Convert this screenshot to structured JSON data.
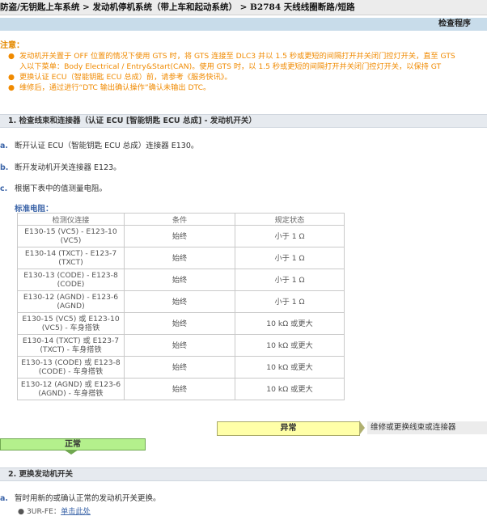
{
  "breadcrumb": {
    "text": "防盗/无钥匙上车系统 > 发动机停机系统（带上车和起动系统） > B2784 天线线圈断路/短路"
  },
  "procedure_header": "检查程序",
  "notice": {
    "title": "注意：",
    "items": [
      {
        "line1": "发动机开关置于 OFF 位置的情况下使用 GTS 时，将 GTS 连接至 DLC3 并以 1.5 秒或更短的间隔打开并关闭门控灯开关，直至 GTS",
        "line2": "入以下菜单：Body Electrical / Entry&Start(CAN)。使用 GTS 时，以 1.5 秒或更短的间隔打开并关闭门控灯开关，以保持 GT"
      },
      {
        "line1": "更换认证 ECU（智能钥匙 ECU 总成）前，请参考《服务快讯》。"
      },
      {
        "line1": "维修后，通过进行“DTC 输出确认操作”确认未输出 DTC。"
      }
    ]
  },
  "section1": {
    "title": "1. 检查线束和连接器（认证 ECU [智能钥匙 ECU 总成] - 发动机开关）",
    "steps": [
      {
        "letter": "a.",
        "text": "断开认证 ECU（智能钥匙 ECU 总成）连接器 E130。"
      },
      {
        "letter": "b.",
        "text": "断开发动机开关连接器 E123。"
      },
      {
        "letter": "c.",
        "text": "根据下表中的值测量电阻。"
      }
    ],
    "standard_label": "标准电阻：",
    "table": {
      "headers": [
        "检测仪连接",
        "条件",
        "规定状态"
      ],
      "rows": [
        [
          "E130-15 (VC5) - E123-10 (VC5)",
          "始终",
          "小于 1 Ω"
        ],
        [
          "E130-14 (TXCT) - E123-7 (TXCT)",
          "始终",
          "小于 1 Ω"
        ],
        [
          "E130-13 (CODE) - E123-8 (CODE)",
          "始终",
          "小于 1 Ω"
        ],
        [
          "E130-12 (AGND) - E123-6 (AGND)",
          "始终",
          "小于 1 Ω"
        ],
        [
          "E130-15 (VC5) 或 E123-10 (VC5) - 车身搭铁",
          "始终",
          "10 kΩ 或更大"
        ],
        [
          "E130-14 (TXCT) 或 E123-7 (TXCT) - 车身搭铁",
          "始终",
          "10 kΩ 或更大"
        ],
        [
          "E130-13 (CODE) 或 E123-8 (CODE) - 车身搭铁",
          "始终",
          "10 kΩ 或更大"
        ],
        [
          "E130-12 (AGND) 或 E123-6 (AGND) - 车身搭铁",
          "始终",
          "10 kΩ 或更大"
        ]
      ]
    }
  },
  "result": {
    "abnormal_label": "异常",
    "abnormal_action": "维修或更换线束或连接器",
    "normal_label": "正常"
  },
  "section2": {
    "title": "2. 更换发动机开关",
    "step_letter": "a.",
    "step_text": "暂时用新的或确认正常的发动机开关更换。",
    "sub_prefix": "3UR-FE：",
    "sub_link": "单击此处"
  },
  "colors": {
    "notice": "#f08a00",
    "step_letter": "#3b64a8",
    "section_bg": "#e6eaef",
    "proc_bg": "#c8dcea",
    "abnormal_box": "#ffffa8",
    "normal_box": "#b4f08c"
  }
}
